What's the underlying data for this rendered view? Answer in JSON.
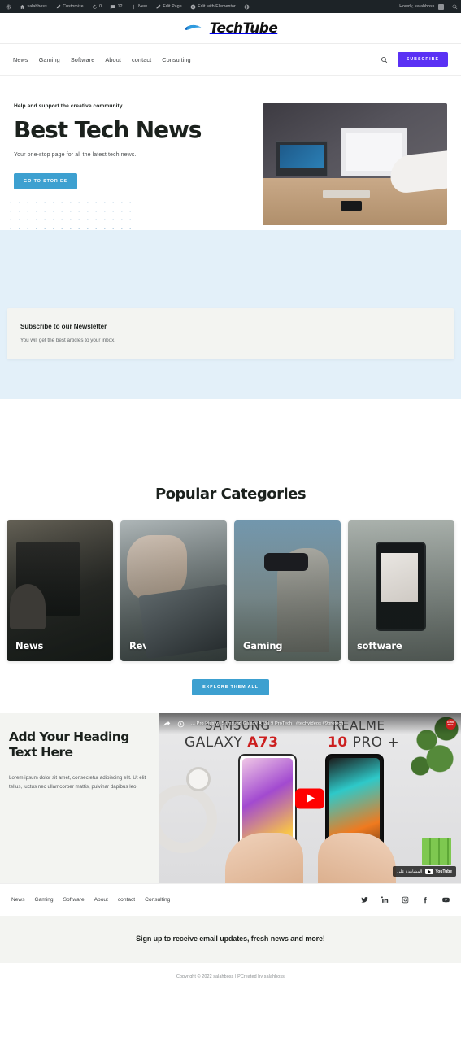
{
  "adminbar": {
    "wp_logo": "wordpress-logo-icon",
    "site_name": "salahboss",
    "customize": "Customize",
    "updates_count": "0",
    "comments_count": "12",
    "new": "New",
    "edit_page": "Edit Page",
    "edit_elementor": "Edit with Elementor",
    "howdy": "Howdy, salahboss"
  },
  "brand": {
    "name": "TechTube",
    "mark": "swoosh-icon",
    "accent_blue": "#3da0d0",
    "accent_purple": "#5a31f4"
  },
  "nav": {
    "items": [
      {
        "label": "News"
      },
      {
        "label": "Gaming"
      },
      {
        "label": "Software"
      },
      {
        "label": "About"
      },
      {
        "label": "contact"
      },
      {
        "label": "Consulting"
      }
    ],
    "search_icon": "search-icon",
    "subscribe_label": "SUBSCRIBE"
  },
  "hero": {
    "eyebrow": "Help and support the creative community",
    "title": "Best Tech News",
    "subtitle": "Your one-stop page for all the latest tech news.",
    "cta_label": "GO TO STORIES",
    "image_alt": "people-working-on-laptops-at-desk"
  },
  "newsletter": {
    "title": "Subscribe to our Newsletter",
    "subtitle": "You will get the best articles to your inbox."
  },
  "categories": {
    "title": "Popular Categories",
    "cards": [
      {
        "label": "News",
        "image_alt": "camera-crew-filming"
      },
      {
        "label": "Reviews",
        "image_alt": "hand-using-stylus-on-tablet"
      },
      {
        "label": "Gaming",
        "image_alt": "woman-wearing-vr-headset"
      },
      {
        "label": "software",
        "image_alt": "hand-holding-smartphone-camera"
      }
    ],
    "cta_label": "EXPLORE THEM ALL"
  },
  "promo": {
    "title": "Add Your Heading Text Here",
    "body": "Lorem ipsum dolor sit amet, consectetur adipiscing elit. Ut elit tellus, luctus nec ullamcorper mattis, pulvinar dapibus leo."
  },
  "video": {
    "title": "... Pro Plus vs Samsung Galaxy A73 | 9 ProTech | #techvideos #9protech",
    "share_icon": "share-icon",
    "watch_later_icon": "watch-later-clock-icon",
    "channel_badge": "9 PRO TECH",
    "brand_left_top": "SAMSUNG",
    "brand_left_model": "GALAXY ",
    "brand_left_model_accent": "A73",
    "brand_right_top": "REALME",
    "brand_right_model_accent": "10",
    "brand_right_model": " PRO +",
    "play_button": "youtube-play-button",
    "watch_on_label": "المشاهدة على",
    "youtube_word": "YouTube"
  },
  "footer": {
    "items": [
      {
        "label": "News"
      },
      {
        "label": "Gaming"
      },
      {
        "label": "Software"
      },
      {
        "label": "About"
      },
      {
        "label": "contact"
      },
      {
        "label": "Consulting"
      }
    ],
    "socials": [
      {
        "name": "twitter-icon"
      },
      {
        "name": "linkedin-icon"
      },
      {
        "name": "instagram-icon"
      },
      {
        "name": "facebook-icon"
      },
      {
        "name": "youtube-icon"
      }
    ],
    "signup_text": "Sign up to receive email updates, fresh news and more!",
    "copyright": "Copyright © 2022 salahboss | PCreated by salahboss"
  }
}
